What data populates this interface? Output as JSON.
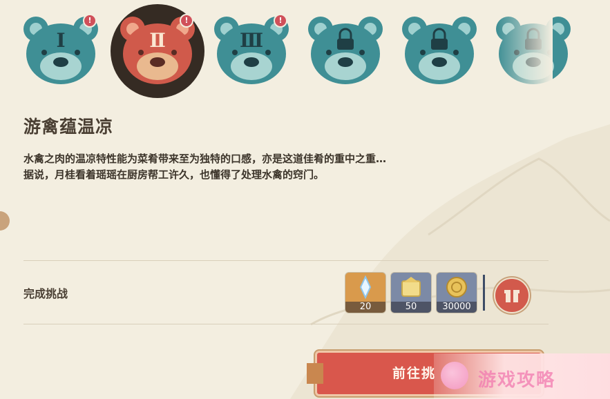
{
  "stages": [
    {
      "numeral": "Ⅰ",
      "state": "unlocked",
      "alert": "!",
      "color": "#3f8f95"
    },
    {
      "numeral": "Ⅱ",
      "state": "selected",
      "alert": "!",
      "color": "#d05a4b"
    },
    {
      "numeral": "Ⅲ",
      "state": "unlocked",
      "alert": "!",
      "color": "#3f8f95"
    },
    {
      "numeral": "",
      "state": "locked",
      "alert": "",
      "color": "#3f8f95",
      "icon": "lock-icon"
    },
    {
      "numeral": "",
      "state": "locked",
      "alert": "",
      "color": "#3f8f95",
      "icon": "lock-icon"
    },
    {
      "numeral": "",
      "state": "locked",
      "alert": "",
      "color": "#3f8f95",
      "icon": "lock-icon"
    }
  ],
  "dish": {
    "title": "游禽蕴温凉",
    "description_line1": "水禽之肉的温凉特性能为菜肴带来至为独特的口感，亦是这道佳肴的重中之重…",
    "description_line2": "据说，月桂看着瑶瑶在厨房帮工许久，也懂得了处理水禽的窍门。"
  },
  "challenge": {
    "label": "完成挑战",
    "rewards": [
      {
        "icon": "primogem-icon",
        "qty": "20",
        "bg": "#d99a4c"
      },
      {
        "icon": "hero-wit-icon",
        "qty": "50",
        "bg": "#7c8aa6"
      },
      {
        "icon": "mora-icon",
        "qty": "30000",
        "bg": "#7c8aa6"
      }
    ],
    "gift_icon": "gift-icon"
  },
  "go_button": {
    "label": "前往挑"
  },
  "watermark": {
    "text": "游戏攻略"
  }
}
